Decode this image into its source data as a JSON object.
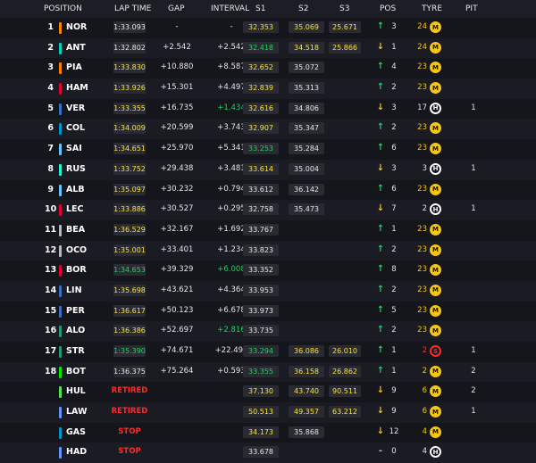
{
  "header": {
    "position": "POSITION",
    "lap_time": "LAP TIME",
    "gap": "GAP",
    "interval": "INTERVAL",
    "s1": "S1",
    "s2": "S2",
    "s3": "S3",
    "pos": "POS",
    "tyre": "TYRE",
    "pit": "PIT"
  },
  "colors": {
    "green": "#23d160",
    "yellow": "#f5e14b",
    "red": "#ff2a2a",
    "medium_tyre": "#f5c518",
    "hard_tyre": "#ffffff",
    "soft_tyre": "#ff2a2a"
  },
  "rows": [
    {
      "pos": "1",
      "team": "#ff8000",
      "code": "NOR",
      "lap": "1:33.093",
      "lap_color": "white",
      "gap": "-",
      "interval": "-",
      "int_color": "white",
      "s1": "32.353",
      "s1c": "yellow",
      "s2": "35.069",
      "s2c": "yellow",
      "s3": "25.671",
      "s3c": "yellow",
      "arrow": "up",
      "arrow_icon": "↑",
      "pchg": "3",
      "tage": "24",
      "tage_c": "fresh",
      "tyre": "M",
      "pit": ""
    },
    {
      "pos": "2",
      "team": "#00d2be",
      "code": "ANT",
      "lap": "1:32.802",
      "lap_color": "white",
      "gap": "+2.542",
      "interval": "+2.542",
      "int_color": "white",
      "s1": "32.418",
      "s1c": "green",
      "s2": "34.518",
      "s2c": "yellow",
      "s3": "25.866",
      "s3c": "yellow",
      "arrow": "down",
      "arrow_icon": "↓",
      "pchg": "1",
      "tage": "24",
      "tage_c": "fresh",
      "tyre": "M",
      "pit": ""
    },
    {
      "pos": "3",
      "team": "#ff8000",
      "code": "PIA",
      "lap": "1:33.830",
      "lap_color": "yellow",
      "gap": "+10.880",
      "interval": "+8.587",
      "int_color": "white",
      "s1": "32.652",
      "s1c": "yellow",
      "s2": "35.072",
      "s2c": "white",
      "s3": "",
      "s3c": "white",
      "arrow": "up",
      "arrow_icon": "↑",
      "pchg": "4",
      "tage": "23",
      "tage_c": "fresh",
      "tyre": "M",
      "pit": ""
    },
    {
      "pos": "4",
      "team": "#e8002d",
      "code": "HAM",
      "lap": "1:33.926",
      "lap_color": "yellow",
      "gap": "+15.301",
      "interval": "+4.497",
      "int_color": "white",
      "s1": "32.839",
      "s1c": "yellow",
      "s2": "35.313",
      "s2c": "white",
      "s3": "",
      "s3c": "white",
      "arrow": "up",
      "arrow_icon": "↑",
      "pchg": "2",
      "tage": "23",
      "tage_c": "fresh",
      "tyre": "M",
      "pit": ""
    },
    {
      "pos": "5",
      "team": "#3671c6",
      "code": "VER",
      "lap": "1:33.355",
      "lap_color": "yellow",
      "gap": "+16.735",
      "interval": "+1.434",
      "int_color": "green",
      "s1": "32.616",
      "s1c": "yellow",
      "s2": "34.806",
      "s2c": "white",
      "s3": "",
      "s3c": "white",
      "arrow": "down",
      "arrow_icon": "↓",
      "pchg": "3",
      "tage": "17",
      "tage_c": "used",
      "tyre": "H",
      "pit": "1"
    },
    {
      "pos": "6",
      "team": "#0093cc",
      "code": "COL",
      "lap": "1:34.009",
      "lap_color": "yellow",
      "gap": "+20.599",
      "interval": "+3.743",
      "int_color": "white",
      "s1": "32.907",
      "s1c": "yellow",
      "s2": "35.347",
      "s2c": "white",
      "s3": "",
      "s3c": "white",
      "arrow": "up",
      "arrow_icon": "↑",
      "pchg": "2",
      "tage": "23",
      "tage_c": "fresh",
      "tyre": "M",
      "pit": ""
    },
    {
      "pos": "7",
      "team": "#64c4ff",
      "code": "SAI",
      "lap": "1:34.651",
      "lap_color": "yellow",
      "gap": "+25.970",
      "interval": "+5.341",
      "int_color": "white",
      "s1": "33.253",
      "s1c": "green",
      "s2": "35.284",
      "s2c": "white",
      "s3": "",
      "s3c": "white",
      "arrow": "up",
      "arrow_icon": "↑",
      "pchg": "6",
      "tage": "23",
      "tage_c": "fresh",
      "tyre": "M",
      "pit": ""
    },
    {
      "pos": "8",
      "team": "#27f4d2",
      "code": "RUS",
      "lap": "1:33.752",
      "lap_color": "yellow",
      "gap": "+29.438",
      "interval": "+3.481",
      "int_color": "white",
      "s1": "33.614",
      "s1c": "yellow",
      "s2": "35.004",
      "s2c": "white",
      "s3": "",
      "s3c": "white",
      "arrow": "down",
      "arrow_icon": "↓",
      "pchg": "3",
      "tage": "3",
      "tage_c": "used",
      "tyre": "H",
      "pit": "1"
    },
    {
      "pos": "9",
      "team": "#64c4ff",
      "code": "ALB",
      "lap": "1:35.097",
      "lap_color": "yellow",
      "gap": "+30.232",
      "interval": "+0.794",
      "int_color": "white",
      "s1": "33.612",
      "s1c": "white",
      "s2": "36.142",
      "s2c": "white",
      "s3": "",
      "s3c": "white",
      "arrow": "up",
      "arrow_icon": "↑",
      "pchg": "6",
      "tage": "23",
      "tage_c": "fresh",
      "tyre": "M",
      "pit": ""
    },
    {
      "pos": "10",
      "team": "#e8002d",
      "code": "LEC",
      "lap": "1:33.886",
      "lap_color": "yellow",
      "gap": "+30.527",
      "interval": "+0.295",
      "int_color": "white",
      "s1": "32.758",
      "s1c": "white",
      "s2": "35.473",
      "s2c": "white",
      "s3": "",
      "s3c": "white",
      "arrow": "down",
      "arrow_icon": "↓",
      "pchg": "7",
      "tage": "2",
      "tage_c": "used",
      "tyre": "H",
      "pit": "1"
    },
    {
      "pos": "11",
      "team": "#b6babd",
      "code": "BEA",
      "lap": "1:36.529",
      "lap_color": "yellow",
      "gap": "+32.167",
      "interval": "+1.692",
      "int_color": "white",
      "s1": "33.767",
      "s1c": "white",
      "s2": "",
      "s2c": "white",
      "s3": "",
      "s3c": "white",
      "arrow": "up",
      "arrow_icon": "↑",
      "pchg": "1",
      "tage": "23",
      "tage_c": "fresh",
      "tyre": "M",
      "pit": ""
    },
    {
      "pos": "12",
      "team": "#b6babd",
      "code": "OCO",
      "lap": "1:35.001",
      "lap_color": "yellow",
      "gap": "+33.401",
      "interval": "+1.234",
      "int_color": "white",
      "s1": "33.823",
      "s1c": "white",
      "s2": "",
      "s2c": "white",
      "s3": "",
      "s3c": "white",
      "arrow": "up",
      "arrow_icon": "↑",
      "pchg": "2",
      "tage": "23",
      "tage_c": "fresh",
      "tyre": "M",
      "pit": ""
    },
    {
      "pos": "13",
      "team": "#e8002d",
      "code": "BOR",
      "lap": "1:34.653",
      "lap_color": "green",
      "gap": "+39.329",
      "interval": "+6.008",
      "int_color": "green",
      "s1": "33.352",
      "s1c": "white",
      "s2": "",
      "s2c": "white",
      "s3": "",
      "s3c": "white",
      "arrow": "up",
      "arrow_icon": "↑",
      "pchg": "8",
      "tage": "23",
      "tage_c": "fresh",
      "tyre": "M",
      "pit": ""
    },
    {
      "pos": "14",
      "team": "#3671c6",
      "code": "LIN",
      "lap": "1:35.698",
      "lap_color": "yellow",
      "gap": "+43.621",
      "interval": "+4.364",
      "int_color": "white",
      "s1": "33.953",
      "s1c": "white",
      "s2": "",
      "s2c": "white",
      "s3": "",
      "s3c": "white",
      "arrow": "up",
      "arrow_icon": "↑",
      "pchg": "2",
      "tage": "23",
      "tage_c": "fresh",
      "tyre": "M",
      "pit": ""
    },
    {
      "pos": "15",
      "team": "#3671c6",
      "code": "PER",
      "lap": "1:36.617",
      "lap_color": "yellow",
      "gap": "+50.123",
      "interval": "+6.678",
      "int_color": "white",
      "s1": "33.973",
      "s1c": "white",
      "s2": "",
      "s2c": "white",
      "s3": "",
      "s3c": "white",
      "arrow": "up",
      "arrow_icon": "↑",
      "pchg": "5",
      "tage": "23",
      "tage_c": "fresh",
      "tyre": "M",
      "pit": ""
    },
    {
      "pos": "16",
      "team": "#229971",
      "code": "ALO",
      "lap": "1:36.386",
      "lap_color": "yellow",
      "gap": "+52.697",
      "interval": "+2.816",
      "int_color": "green",
      "s1": "33.735",
      "s1c": "white",
      "s2": "",
      "s2c": "white",
      "s3": "",
      "s3c": "white",
      "arrow": "up",
      "arrow_icon": "↑",
      "pchg": "2",
      "tage": "23",
      "tage_c": "fresh",
      "tyre": "M",
      "pit": ""
    },
    {
      "pos": "17",
      "team": "#229971",
      "code": "STR",
      "lap": "1:35.390",
      "lap_color": "green",
      "gap": "+74.671",
      "interval": "+22.492",
      "int_color": "white",
      "s1": "33.294",
      "s1c": "green",
      "s2": "36.086",
      "s2c": "yellow",
      "s3": "26.010",
      "s3c": "yellow",
      "arrow": "up",
      "arrow_icon": "↑",
      "pchg": "1",
      "tage": "2",
      "tage_c": "soft",
      "tyre": "S",
      "pit": "1"
    },
    {
      "pos": "18",
      "team": "#00e701",
      "code": "BOT",
      "lap": "1:36.375",
      "lap_color": "white",
      "gap": "+75.264",
      "interval": "+0.593",
      "int_color": "white",
      "s1": "33.355",
      "s1c": "green",
      "s2": "36.158",
      "s2c": "yellow",
      "s3": "26.862",
      "s3c": "yellow",
      "arrow": "up",
      "arrow_icon": "↑",
      "pchg": "1",
      "tage": "2",
      "tage_c": "fresh",
      "tyre": "M",
      "pit": "2"
    },
    {
      "pos": "",
      "team": "#52e252",
      "code": "HUL",
      "status": "RETIRED",
      "gap": "",
      "interval": "",
      "int_color": "white",
      "s1": "37.130",
      "s1c": "yellow",
      "s2": "43.740",
      "s2c": "yellow",
      "s3": "90.511",
      "s3c": "yellow",
      "arrow": "down",
      "arrow_icon": "↓",
      "pchg": "9",
      "tage": "6",
      "tage_c": "fresh",
      "tyre": "M",
      "pit": "2"
    },
    {
      "pos": "",
      "team": "#6692ff",
      "code": "LAW",
      "status": "RETIRED",
      "gap": "",
      "interval": "",
      "int_color": "white",
      "s1": "50.513",
      "s1c": "yellow",
      "s2": "49.357",
      "s2c": "yellow",
      "s3": "63.212",
      "s3c": "yellow",
      "arrow": "down",
      "arrow_icon": "↓",
      "pchg": "9",
      "tage": "6",
      "tage_c": "fresh",
      "tyre": "M",
      "pit": "1"
    },
    {
      "pos": "",
      "team": "#0093cc",
      "code": "GAS",
      "status": "STOP",
      "gap": "",
      "interval": "",
      "int_color": "white",
      "s1": "34.173",
      "s1c": "yellow",
      "s2": "35.868",
      "s2c": "white",
      "s3": "",
      "s3c": "white",
      "arrow": "down",
      "arrow_icon": "↓",
      "pchg": "12",
      "tage": "4",
      "tage_c": "fresh",
      "tyre": "M",
      "pit": ""
    },
    {
      "pos": "",
      "team": "#6692ff",
      "code": "HAD",
      "status": "STOP",
      "gap": "",
      "interval": "",
      "int_color": "white",
      "s1": "33.678",
      "s1c": "white",
      "s2": "",
      "s2c": "white",
      "s3": "",
      "s3c": "white",
      "arrow": "flat",
      "arrow_icon": "-",
      "pchg": "0",
      "tage": "4",
      "tage_c": "used",
      "tyre": "H",
      "pit": ""
    }
  ]
}
